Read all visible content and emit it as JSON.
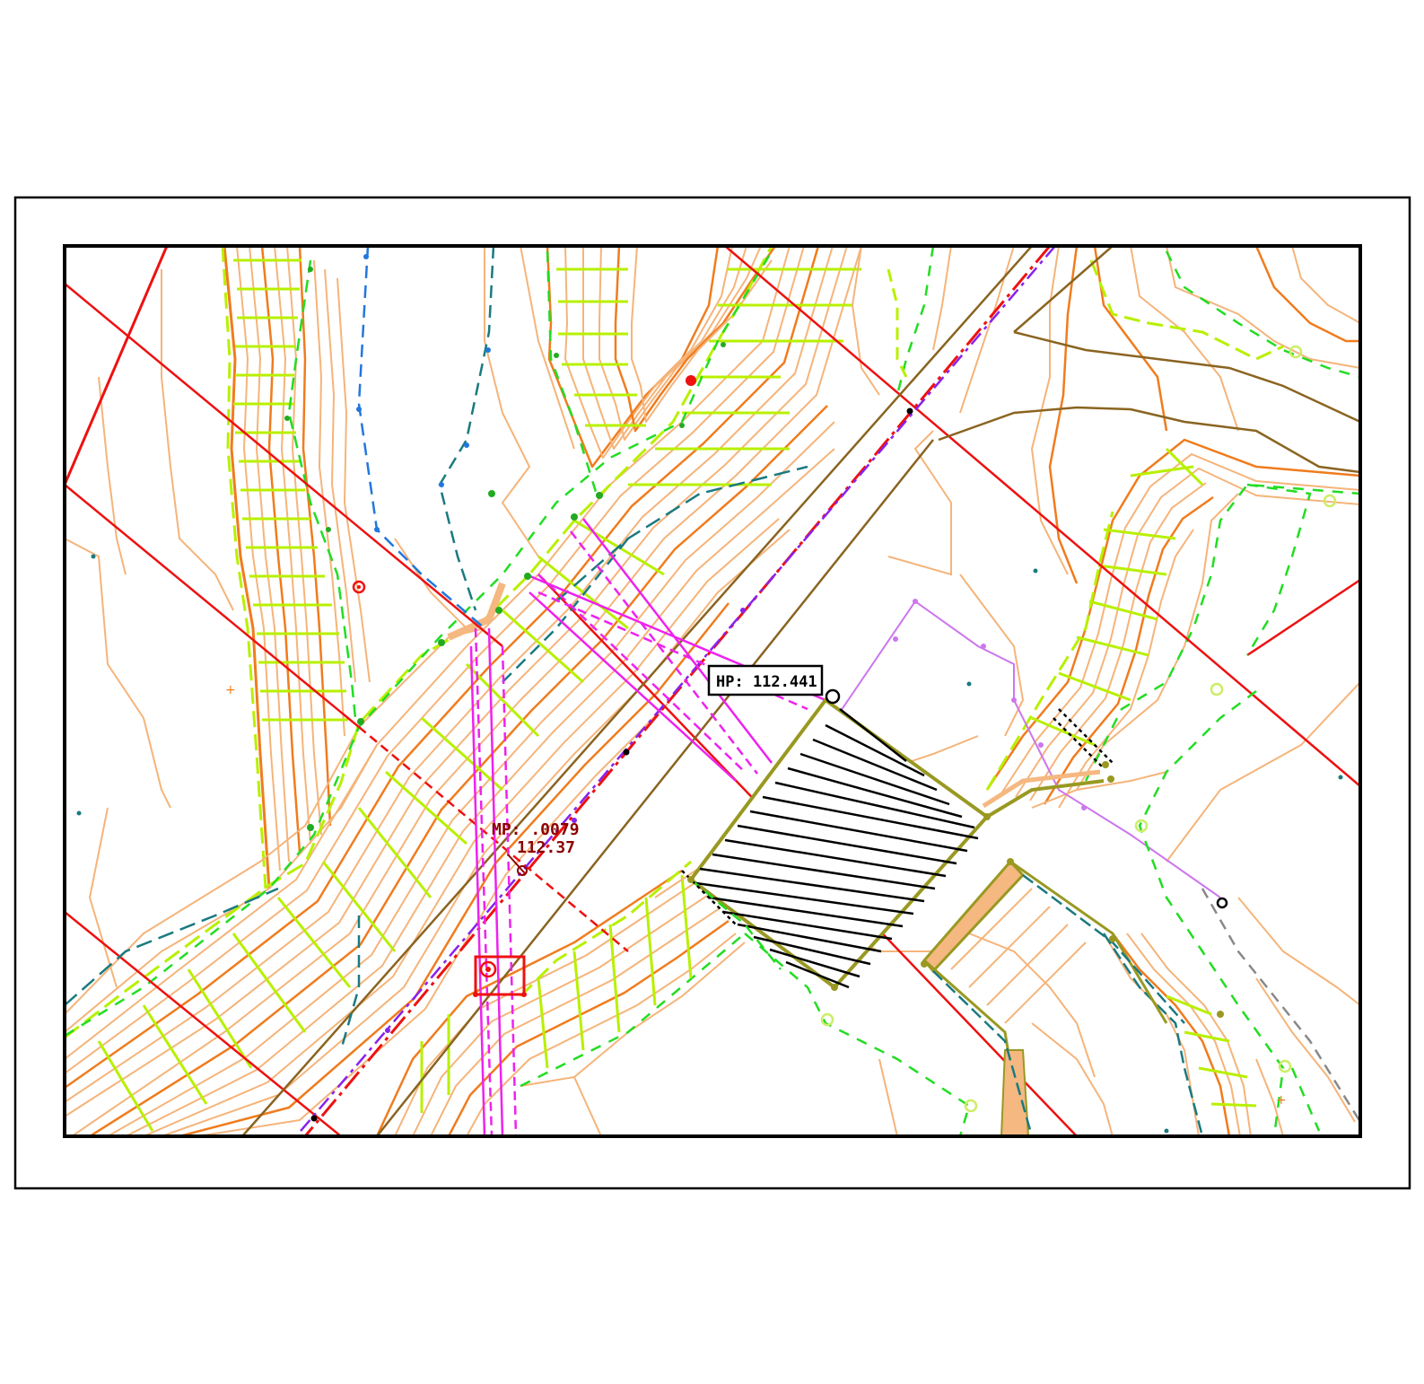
{
  "labels": {
    "hp_label": "HP: 112.441",
    "mp_label_line1": "MP: .0079",
    "mp_label_line2": "112.37"
  },
  "colors": {
    "frame": "#000000",
    "contour_light": "#f5b47a",
    "contour_dark": "#f07c1e",
    "hatch_green": "#b8f000",
    "boundary_green": "#22dd22",
    "property_line": "#ee1111",
    "road_brown": "#8a6420",
    "water_teal": "#1a7a80",
    "water_blue": "#2277dd",
    "pipe_magenta": "#ee22ee",
    "pipe_violet": "#cc77ee",
    "text_dark_red": "#8b0000",
    "fill_tan": "#f5b880",
    "olive": "#999922",
    "purple_dash": "#8822ee"
  },
  "icons": {
    "point_marker": "circle-point-icon",
    "survey_marker": "target-marker-icon"
  }
}
